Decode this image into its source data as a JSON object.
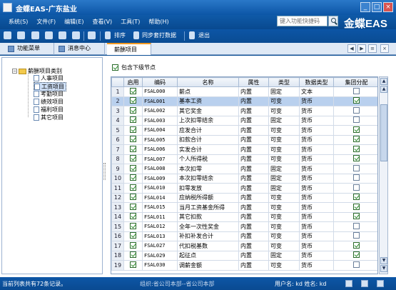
{
  "window": {
    "title": "金蝶EAS-广东盐业"
  },
  "menu": [
    "系统(S)",
    "文件(F)",
    "编辑(E)",
    "查看(V)",
    "工具(T)",
    "帮助(H)"
  ],
  "function_search": {
    "placeholder": "键入功能快捷码"
  },
  "brand": "金蝶EAS",
  "toolbar": {
    "sort": "排序",
    "sync_print": "同步套打数据",
    "exit": "退出"
  },
  "tabs": [
    "功能菜单",
    "消息中心",
    "薪酬项目"
  ],
  "tree": {
    "root": "薪酬项目类别",
    "items": [
      "人事项目",
      "工资项目",
      "考勤项目",
      "绩效项目",
      "福利项目",
      "其它项目"
    ],
    "selected_index": 1
  },
  "include_children": {
    "label": "包含下级节点",
    "checked": true
  },
  "grid": {
    "headers": [
      "",
      "启用",
      "编码",
      "名称",
      "属性",
      "类型",
      "数据类型",
      "集团分配"
    ],
    "rows": [
      {
        "n": "1",
        "enabled": true,
        "code": "FSAL000",
        "name": "薪点",
        "attr": "内置",
        "type": "固定",
        "dtype": "文本",
        "group": false
      },
      {
        "n": "2",
        "enabled": true,
        "code": "FSAL001",
        "name": "基本工资",
        "attr": "内置",
        "type": "可变",
        "dtype": "货币",
        "group": true
      },
      {
        "n": "3",
        "enabled": true,
        "code": "FSAL002",
        "name": "其它奖金",
        "attr": "内置",
        "type": "可变",
        "dtype": "货币",
        "group": false
      },
      {
        "n": "4",
        "enabled": true,
        "code": "FSAL003",
        "name": "上次扣零结余",
        "attr": "内置",
        "type": "固定",
        "dtype": "货币",
        "group": false
      },
      {
        "n": "5",
        "enabled": true,
        "code": "FSAL004",
        "name": "应发合计",
        "attr": "内置",
        "type": "可变",
        "dtype": "货币",
        "group": true
      },
      {
        "n": "6",
        "enabled": true,
        "code": "FSAL005",
        "name": "扣款合计",
        "attr": "内置",
        "type": "可变",
        "dtype": "货币",
        "group": true
      },
      {
        "n": "7",
        "enabled": true,
        "code": "FSAL006",
        "name": "实发合计",
        "attr": "内置",
        "type": "可变",
        "dtype": "货币",
        "group": true
      },
      {
        "n": "8",
        "enabled": true,
        "code": "FSAL007",
        "name": "个人所得税",
        "attr": "内置",
        "type": "可变",
        "dtype": "货币",
        "group": true
      },
      {
        "n": "9",
        "enabled": true,
        "code": "FSAL008",
        "name": "本次扣零",
        "attr": "内置",
        "type": "固定",
        "dtype": "货币",
        "group": false
      },
      {
        "n": "10",
        "enabled": true,
        "code": "FSAL009",
        "name": "本次扣零结余",
        "attr": "内置",
        "type": "固定",
        "dtype": "货币",
        "group": false
      },
      {
        "n": "11",
        "enabled": true,
        "code": "FSAL010",
        "name": "扣零发放",
        "attr": "内置",
        "type": "固定",
        "dtype": "货币",
        "group": false
      },
      {
        "n": "12",
        "enabled": true,
        "code": "FSAL014",
        "name": "应纳税所得额",
        "attr": "内置",
        "type": "可变",
        "dtype": "货币",
        "group": true
      },
      {
        "n": "13",
        "enabled": true,
        "code": "FSAL015",
        "name": "当月工资基金所得",
        "attr": "内置",
        "type": "可变",
        "dtype": "货币",
        "group": true
      },
      {
        "n": "14",
        "enabled": true,
        "code": "FSAL011",
        "name": "其它扣款",
        "attr": "内置",
        "type": "可变",
        "dtype": "货币",
        "group": true
      },
      {
        "n": "15",
        "enabled": true,
        "code": "FSAL012",
        "name": "全年一次性奖金",
        "attr": "内置",
        "type": "可变",
        "dtype": "货币",
        "group": false
      },
      {
        "n": "16",
        "enabled": true,
        "code": "FSAL013",
        "name": "补扣补发合计",
        "attr": "内置",
        "type": "可变",
        "dtype": "货币",
        "group": false
      },
      {
        "n": "17",
        "enabled": true,
        "code": "FSAL027",
        "name": "代扣税基数",
        "attr": "内置",
        "type": "可变",
        "dtype": "货币",
        "group": true
      },
      {
        "n": "18",
        "enabled": true,
        "code": "FSAL029",
        "name": "起征点",
        "attr": "内置",
        "type": "固定",
        "dtype": "货币",
        "group": true
      },
      {
        "n": "19",
        "enabled": true,
        "code": "FSAL030",
        "name": "调薪金额",
        "attr": "内置",
        "type": "可变",
        "dtype": "货币",
        "group": false
      }
    ],
    "selected_row": 1
  },
  "status": {
    "left": "当前列表共有72条记录。",
    "org": "组织:省公司本部--省公司本部",
    "user": "用户名: kd 姓名: kd"
  }
}
